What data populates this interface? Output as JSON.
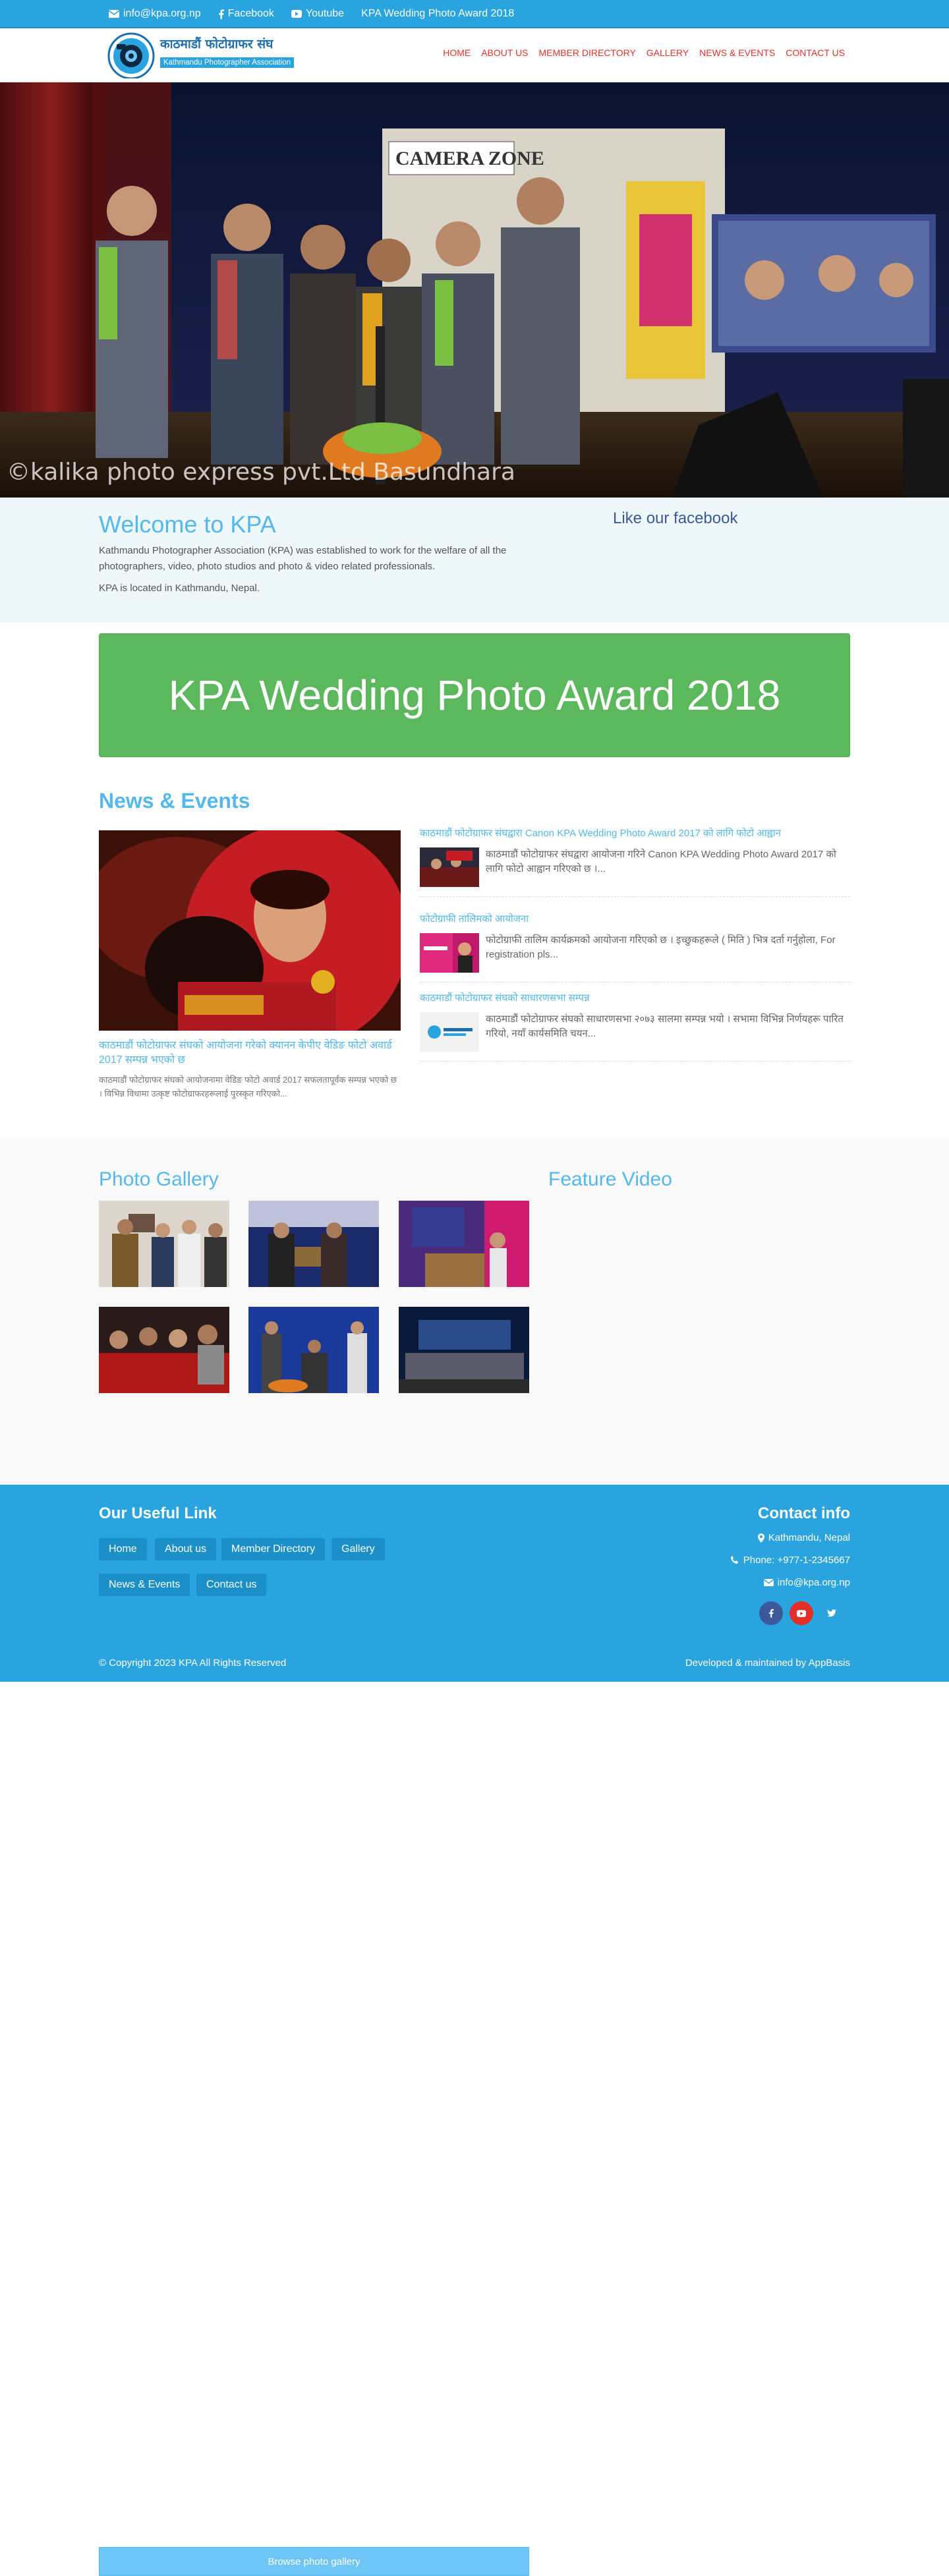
{
  "topbar": {
    "email": "info@kpa.org.np",
    "facebook": "Facebook",
    "youtube": "Youtube",
    "award_link": "KPA Wedding Photo Award 2018"
  },
  "header": {
    "logo_title_np": "काठमाडौं फोटोग्राफर संघ",
    "logo_subtitle": "Kathmandu Photographer Association",
    "nav": [
      "HOME",
      "ABOUT US",
      "MEMBER DIRECTORY",
      "GALLERY",
      "NEWS & EVENTS",
      "CONTACT US"
    ]
  },
  "hero": {
    "watermark": "©kalika photo express pvt.Ltd Basundhara",
    "sign_text": "CAMERA ZONE"
  },
  "welcome": {
    "title": "Welcome to KPA",
    "paragraph1": "Kathmandu Photographer Association (KPA) was established to work for the welfare of all the photographers, video, photo studios and photo & video related professionals.",
    "paragraph2": "KPA is located in Kathmandu, Nepal.",
    "facebook_heading": "Like our facebook"
  },
  "award_banner": {
    "label": "KPA Wedding Photo Award 2018"
  },
  "news": {
    "section_title": "News & Events",
    "featured": {
      "title": "काठमाडौं फोटोग्राफर संघको आयोजना गरेको क्यानन केपीए वेडिङ फोटो अवार्ड 2017 सम्पन्न भएको छ",
      "description": "काठमाडौं फोटोग्राफर संघको आयोजनामा वेडिङ फोटो अवार्ड 2017 सफलतापूर्वक सम्पन्न भएको छ । विभिन्न विधामा उत्कृष्ट फोटोग्राफरहरूलाई पुरस्कृत गरिएको..."
    },
    "items": [
      {
        "title": "काठमाडौं फोटोग्राफर संघद्वारा Canon KPA Wedding Photo Award 2017 को लागि फोटो आह्वान",
        "description": "काठमाडौं फोटोग्राफर संघद्वारा आयोजना गरिने Canon KPA Wedding Photo Award 2017 को लागि फोटो आह्वान गरिएको छ ।..."
      },
      {
        "title": "फोटोग्राफी तालिमको आयोजना",
        "description": "फोटोग्राफी तालिम कार्यक्रमको आयोजना गरिएको छ । इच्छुकहरूले ( मिति ) भित्र दर्ता गर्नुहोला, For registration pls..."
      },
      {
        "title": "काठमाडौं फोटोग्राफर संघको साधारणसभा सम्पन्न",
        "description": "काठमाडौं फोटोग्राफर संघको साधारणसभा २०७३ सालमा सम्पन्न भयो । सभामा विभिन्न निर्णयहरू पारित गरियो, नयाँ कार्यसमिति चयन..."
      }
    ]
  },
  "gallery": {
    "title": "Photo Gallery",
    "browse_label": "Browse photo gallery",
    "video_title": "Feature Video"
  },
  "footer": {
    "links_title": "Our Useful Link",
    "links": [
      "Home",
      "About us",
      "Member Directory",
      "Gallery",
      "News & Events",
      "Contact us"
    ],
    "contact_title": "Contact info",
    "address": "Kathmandu, Nepal",
    "phone": "Phone: +977-1-2345667",
    "email": "info@kpa.org.np",
    "copyright": "© Copyright 2023 KPA All Rights Reserved",
    "developer": "Developed & maintained by AppBasis"
  },
  "colors": {
    "brand_blue": "#2aa4df",
    "accent_light_blue": "#54b8ec",
    "nav_red": "#e8302f",
    "award_green": "#5cb85c"
  },
  "icons": [
    "envelope-icon",
    "facebook-icon",
    "youtube-icon",
    "map-marker-icon",
    "phone-icon",
    "twitter-icon"
  ]
}
